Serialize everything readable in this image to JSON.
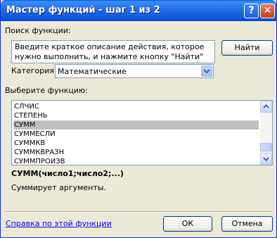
{
  "window": {
    "title": "Мастер функций - шаг 1 из 2"
  },
  "search": {
    "label": "Поиск функции:",
    "description": "Введите краткое описание действия, которое нужно выполнить, и нажмите кнопку \"Найти\"",
    "find_button": "Найти"
  },
  "category": {
    "label": "Категория:",
    "value": "Математические"
  },
  "functions": {
    "label": "Выберите функцию:",
    "items": [
      "СЛЧИС",
      "СТЕПЕНЬ",
      "СУММ",
      "СУММЕСЛИ",
      "СУММКВ",
      "СУММКВРАЗН",
      "СУММПРОИЗВ"
    ],
    "selected": "СУММ"
  },
  "details": {
    "signature": "СУММ(число1;число2;...)",
    "description": "Суммирует аргументы."
  },
  "footer": {
    "help_link": "Справка по этой функции",
    "ok_button": "ОК",
    "cancel_button": "Отмена"
  }
}
